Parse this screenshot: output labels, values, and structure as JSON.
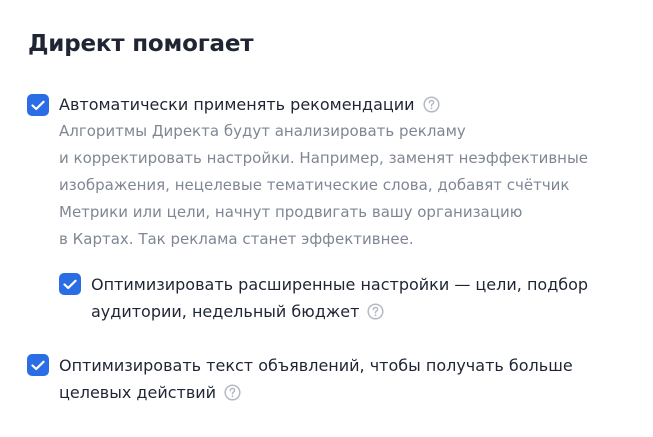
{
  "header": {
    "title": "Директ помогает"
  },
  "options": [
    {
      "checked": true,
      "label_lines": [
        "Автоматически применять рекомендации"
      ],
      "help_icon": "question-circle-icon",
      "description_lines": [
        "Алгоритмы Директа будут анализировать рекламу",
        "и корректировать настройки. Например, заменят неэффективные",
        "изображения, нецелевые тематические слова, добавят счётчик",
        "Метрики или цели, начнут продвигать вашу организацию",
        "в Картах. Так реклама станет эффективнее."
      ]
    },
    {
      "checked": true,
      "label_lines": [
        "Оптимизировать расширенные настройки — цели, подбор",
        "аудитории, недельный бюджет"
      ],
      "help_icon": "question-circle-icon"
    },
    {
      "checked": true,
      "label_lines": [
        "Оптимизировать текст объявлений, чтобы получать больше",
        "целевых действий"
      ],
      "help_icon": "question-circle-icon"
    }
  ],
  "colors": {
    "accent": "#2b6de4",
    "text": "#1f2533",
    "muted": "#7f8794",
    "help_icon": "#b5bac2"
  }
}
